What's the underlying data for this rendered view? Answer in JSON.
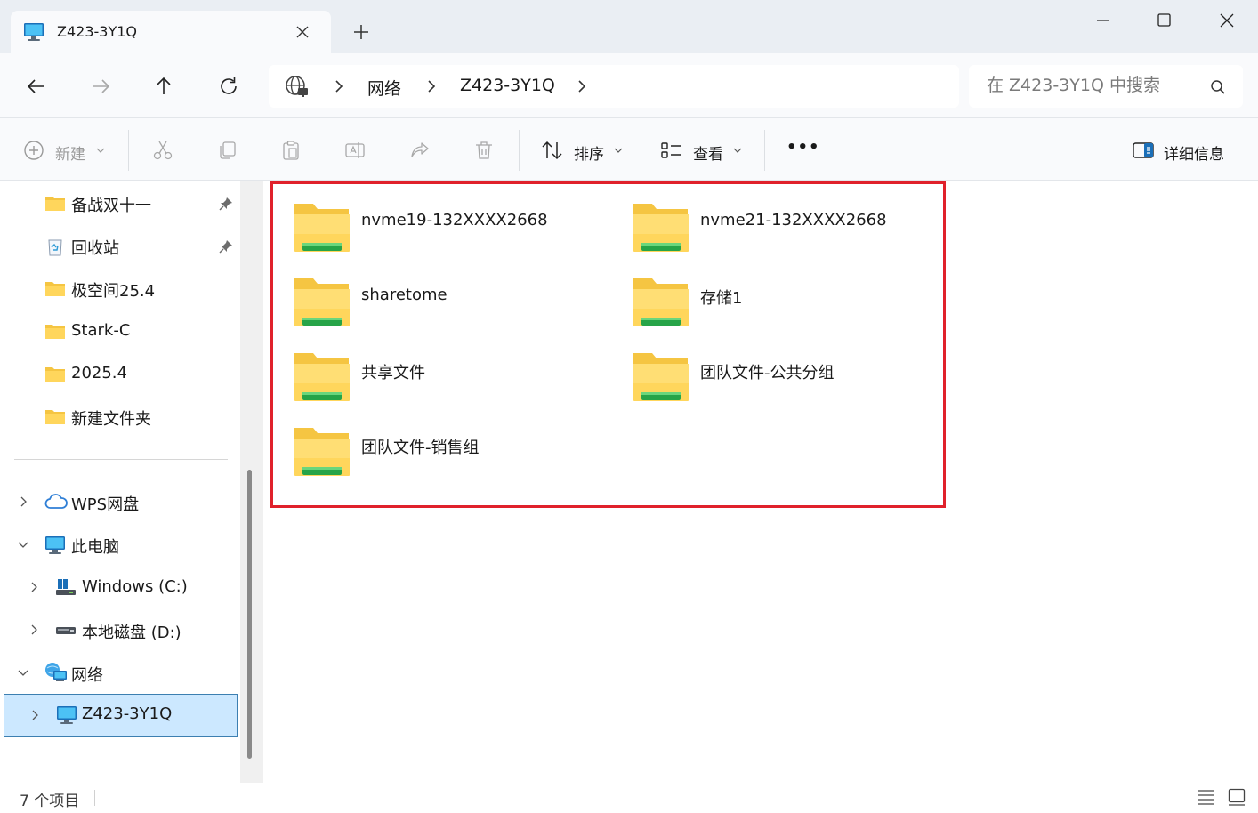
{
  "tab": {
    "title": "Z423-3Y1Q",
    "new_tab": "+"
  },
  "address": {
    "crumbs": [
      "网络",
      "Z423-3Y1Q"
    ]
  },
  "search": {
    "placeholder": "在 Z423-3Y1Q 中搜索"
  },
  "toolbar": {
    "new_label": "新建",
    "sort_label": "排序",
    "view_label": "查看",
    "more_label": "•••",
    "details_label": "详细信息"
  },
  "sidebar": {
    "quick_access": [
      {
        "label": "备战双十一",
        "icon": "folder-icon",
        "pinned": true
      },
      {
        "label": "回收站",
        "icon": "recycle-bin-icon",
        "pinned": true
      },
      {
        "label": "极空间25.4",
        "icon": "folder-icon",
        "pinned": false
      },
      {
        "label": "Stark-C",
        "icon": "folder-icon",
        "pinned": false
      },
      {
        "label": "2025.4",
        "icon": "folder-icon",
        "pinned": false
      },
      {
        "label": "新建文件夹",
        "icon": "folder-icon",
        "pinned": false
      }
    ],
    "tree": [
      {
        "label": "WPS网盘",
        "icon": "cloud-icon",
        "expand": "collapsed"
      },
      {
        "label": "此电脑",
        "icon": "computer-icon",
        "expand": "expanded"
      },
      {
        "label": "Windows (C:)",
        "icon": "windows-drive-icon",
        "expand": "collapsed"
      },
      {
        "label": "本地磁盘 (D:)",
        "icon": "drive-icon",
        "expand": "collapsed"
      },
      {
        "label": "网络",
        "icon": "network-icon",
        "expand": "expanded"
      },
      {
        "label": "Z423-3Y1Q",
        "icon": "computer-icon",
        "expand": "collapsed",
        "selected": true
      }
    ]
  },
  "content": {
    "folders": [
      {
        "name": "nvme19-132XXXX2668"
      },
      {
        "name": "nvme21-132XXXX2668"
      },
      {
        "name": "sharetome"
      },
      {
        "name": "存储1"
      },
      {
        "name": "共享文件"
      },
      {
        "name": "团队文件-公共分组"
      },
      {
        "name": "团队文件-销售组"
      }
    ]
  },
  "status": {
    "count_text": "7 个项目"
  },
  "colors": {
    "accent": "#0067c0",
    "selection": "#cce8ff",
    "highlight_border": "#e0212b"
  }
}
